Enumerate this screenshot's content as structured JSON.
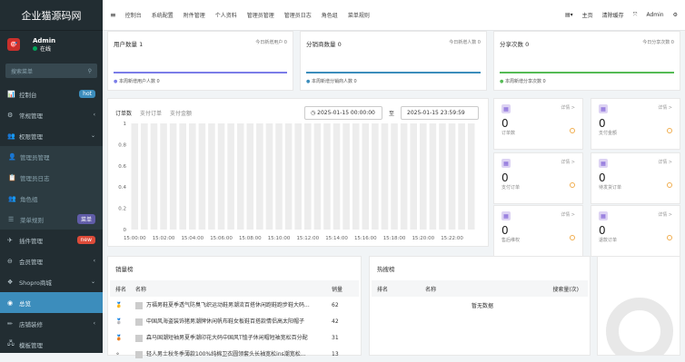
{
  "app": {
    "logo": "企业猫源码网"
  },
  "user": {
    "name": "Admin",
    "status": "在线",
    "avatar": "🎯"
  },
  "sidebar": {
    "search_placeholder": "搜索菜单",
    "items": [
      {
        "icon": "📊",
        "label": "控制台",
        "badge": "hot",
        "badge_color": "#3c8dbc"
      },
      {
        "icon": "⚙",
        "label": "常规管理",
        "arrow": "‹"
      },
      {
        "icon": "👥",
        "label": "权限管理",
        "arrow": "⌄"
      },
      {
        "icon": "👤",
        "label": "管理员管理",
        "sub": true
      },
      {
        "icon": "📋",
        "label": "管理员日志",
        "sub": true
      },
      {
        "icon": "👥",
        "label": "角色组",
        "sub": true
      },
      {
        "icon": "☰",
        "label": "菜单规则",
        "sub": true,
        "badge": "菜单",
        "badge_color": "#605ca8"
      },
      {
        "icon": "✈",
        "label": "插件管理",
        "badge": "new",
        "badge_color": "#dd4b39"
      },
      {
        "icon": "⊖",
        "label": "会员管理",
        "arrow": "‹"
      },
      {
        "icon": "❖",
        "label": "Shopro商城",
        "arrow": "⌄"
      },
      {
        "icon": "◉",
        "label": "总览",
        "active": true
      },
      {
        "icon": "✏",
        "label": "店铺装修",
        "arrow": "‹"
      },
      {
        "icon": "🖧",
        "label": "模板管理"
      }
    ]
  },
  "topbar": {
    "nav": [
      "控制台",
      "系统配置",
      "附件管理",
      "个人资料",
      "管理员管理",
      "管理员日志",
      "角色组",
      "菜单规则"
    ],
    "right": [
      "▤▾",
      "主页",
      "清除缓存",
      "⤧",
      "Admin",
      "⚙"
    ]
  },
  "stats": [
    {
      "title": "用户数量",
      "value": "1",
      "right": "今日新增用户 0",
      "footer": "本周新增用户人数 0",
      "color": "#7b7de8"
    },
    {
      "title": "分销商数量",
      "value": "0",
      "right": "今日新增人数 0",
      "footer": "本周新增分销商人数 0",
      "color": "#3c8dbc"
    },
    {
      "title": "分享次数",
      "value": "0",
      "right": "今日分享次数 0",
      "footer": "本周新增分享次数 0",
      "color": "#55bb55"
    }
  ],
  "order_chart": {
    "tabs": [
      "订单数",
      "支付订单",
      "支付金额"
    ],
    "date_from": "2025-01-15 00:00:00",
    "date_sep": "至",
    "date_to": "2025-01-15 23:59:59"
  },
  "chart_data": {
    "type": "bar",
    "categories": [
      "15:00:00",
      "15:02:00",
      "15:04:00",
      "15:06:00",
      "15:08:00",
      "15:10:00",
      "15:12:00",
      "15:14:00",
      "15:16:00",
      "15:18:00",
      "15:20:00",
      "15:22:00"
    ],
    "yticks": [
      "1",
      "0.8",
      "0.6",
      "0.4",
      "0.2",
      "0"
    ],
    "ylim": [
      0,
      1
    ],
    "title": "",
    "xlabel": "",
    "ylabel": ""
  },
  "mini_cards": [
    {
      "value": "0",
      "label": "订单数",
      "link": "详情 >"
    },
    {
      "value": "0",
      "label": "支付金额",
      "link": "详情 >"
    },
    {
      "value": "0",
      "label": "支付订单",
      "link": "详情 >"
    },
    {
      "value": "0",
      "label": "待发货订单",
      "link": "详情 >"
    },
    {
      "value": "0",
      "label": "售后维权",
      "link": "详情 >"
    },
    {
      "value": "0",
      "label": "退款订单",
      "link": "详情 >"
    }
  ],
  "sales": {
    "title": "销量榜",
    "headers": [
      "排名",
      "名称",
      "销量"
    ],
    "rows": [
      {
        "rank": "🥇",
        "name": "万福男鞋夏季透气防臭飞织运动鞋男潮流百搭休闲跑鞋跑步鞋大码...",
        "value": "62"
      },
      {
        "rank": "🥈",
        "name": "中国风海盗装饰猪男潮牌休闲帆布鞋女板鞋百搭款情侣高太阳帽子",
        "value": "42"
      },
      {
        "rank": "🥉",
        "name": "森马国潮短袖男夏季潮印花大码中国风T恤子休闲帽短袖宽松百分配",
        "value": "31"
      },
      {
        "rank": "⚬",
        "name": "轻人男士秋冬季薄款100%纯棉卫衣圆领套头长袖宽松ins潮宽松...",
        "value": "13"
      }
    ]
  },
  "hot": {
    "title": "热搜榜",
    "headers": [
      "排名",
      "名称",
      "搜索量(次)"
    ],
    "empty": "暂无数据"
  }
}
